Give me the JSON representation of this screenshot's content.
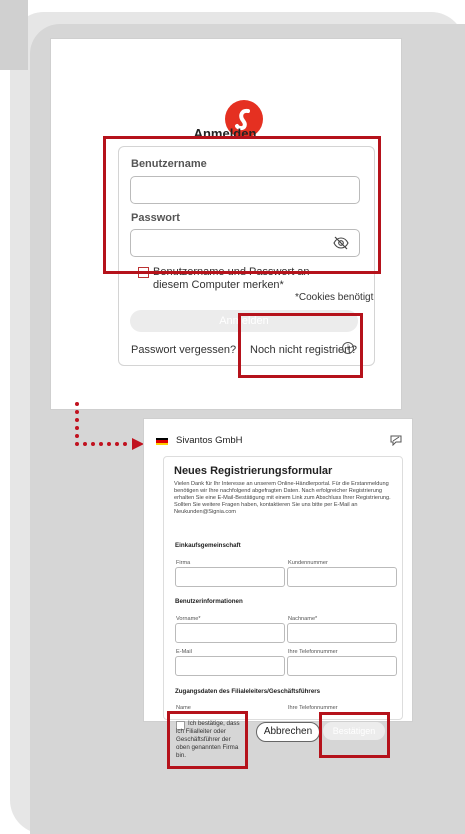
{
  "login": {
    "title": "Anmelden",
    "username_label": "Benutzername",
    "username_value": "",
    "password_label": "Passwort",
    "password_value": "",
    "remember_label": "Benutzername und Passwort an diesem Computer merken*",
    "cookies_note": "*Cookies benötigt",
    "submit_label": "Anmelden",
    "forgot_link": "Passwort vergessen?",
    "register_link": "Noch nicht registriert?",
    "info_glyph": "i",
    "icons": [
      "eye-slash-icon",
      "info-icon",
      "logo-icon"
    ],
    "accent": "#e53021"
  },
  "registration": {
    "company": "Sivantos GmbH",
    "title": "Neues Registrierungsformular",
    "description": "Vielen Dank für Ihr Interesse an unserem Online-Händlerportal. Für die Erstanmeldung benötigen wir Ihre nachfolgend abgefragten Daten. Nach erfolgreicher Registrierung erhalten Sie eine E-Mail-Bestätigung mit einem Link zum Abschluss Ihrer Registrierung. Sollten Sie weitere Fragen haben, kontaktieren Sie uns bitte per E-Mail an Neukunden@Signia.com",
    "sections": {
      "purchasing": "Einkaufsgemeinschaft",
      "user_info": "Benutzerinformationen",
      "access": "Zugangsdaten des Filialeleiters/Geschäftsführers"
    },
    "fields": {
      "firma": "Firma",
      "kundennummer": "Kundennummer",
      "vorname": "Vorname*",
      "nachname": "Nachname*",
      "email": "E-Mail",
      "telefon": "Ihre Telefonnummer",
      "name": "Name",
      "telefon2": "Ihre Telefonnummer"
    },
    "confirm_text": "Ich bestätige, dass ich Filialleiter oder Geschäftsführer der oben genannten Firma bin.",
    "cancel_label": "Abbrechen",
    "confirm_label": "Bestätigen",
    "icons": [
      "germany-flag-icon",
      "feedback-icon"
    ],
    "highlight_color": "#b5121b"
  }
}
